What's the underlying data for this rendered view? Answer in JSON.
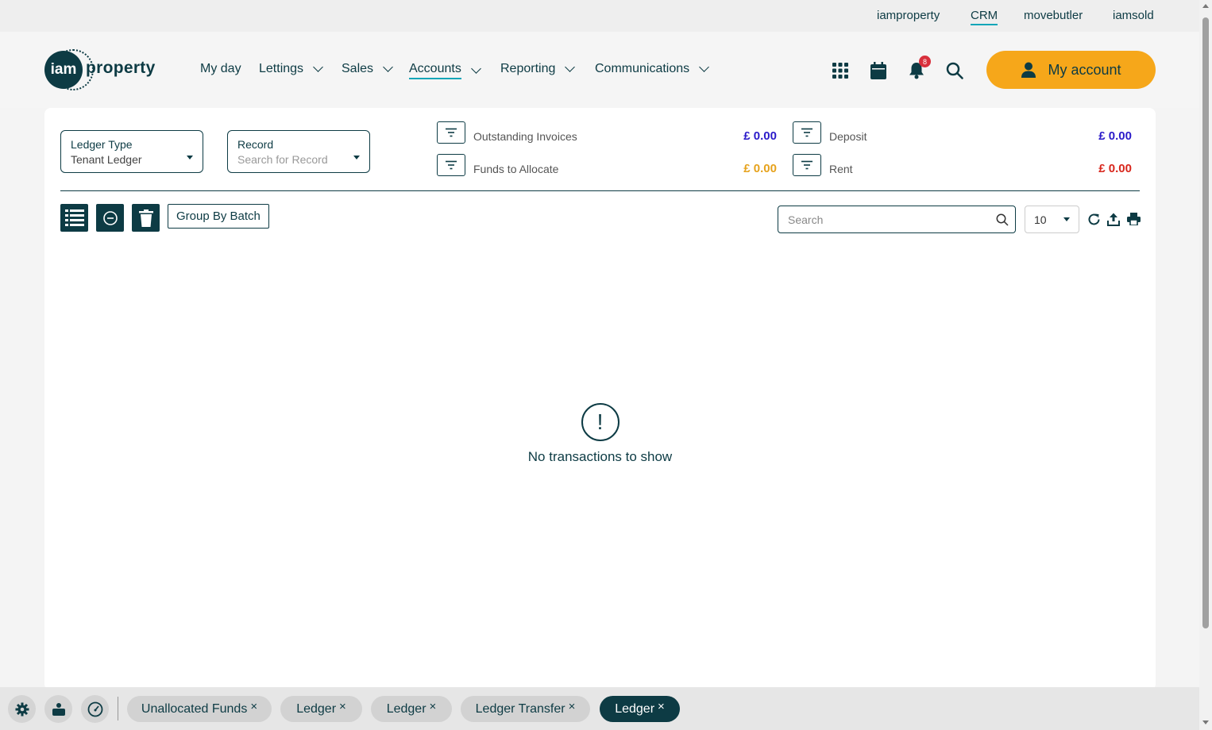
{
  "brandbar": {
    "links": [
      {
        "label": "iamproperty",
        "active": false
      },
      {
        "label": "CRM",
        "active": true
      },
      {
        "label": "movebutler",
        "active": false
      },
      {
        "label": "iamsold",
        "active": false
      }
    ]
  },
  "header": {
    "logo_short": "iam",
    "logo_text": "property",
    "nav": [
      {
        "label": "My day",
        "dropdown": false
      },
      {
        "label": "Lettings",
        "dropdown": true
      },
      {
        "label": "Sales",
        "dropdown": true
      },
      {
        "label": "Accounts",
        "dropdown": true,
        "active": true
      },
      {
        "label": "Reporting",
        "dropdown": true
      },
      {
        "label": "Communications",
        "dropdown": true
      }
    ],
    "icons": [
      "apps-grid-icon",
      "calendar-icon",
      "bell-icon",
      "search-icon"
    ],
    "notification_count": "8",
    "account_label": "My account"
  },
  "filters": {
    "ledger_type": {
      "label": "Ledger Type",
      "value": "Tenant Ledger"
    },
    "record": {
      "label": "Record",
      "placeholder": "Search for Record"
    }
  },
  "summary": {
    "outstanding_invoices": {
      "label": "Outstanding Invoices",
      "amount": "£ 0.00",
      "color": "#2a1ac9"
    },
    "funds_to_allocate": {
      "label": "Funds to Allocate",
      "amount": "£ 0.00",
      "color": "#e6a21c"
    },
    "deposit": {
      "label": "Deposit",
      "amount": "£ 0.00",
      "color": "#2a1ac9"
    },
    "rent": {
      "label": "Rent",
      "amount": "£ 0.00",
      "color": "#d8261c"
    }
  },
  "toolbar": {
    "group_by_batch": "Group By Batch",
    "search_placeholder": "Search",
    "page_size": "10"
  },
  "empty_state": {
    "icon": "!",
    "message": "No transactions to show"
  },
  "bottombar": {
    "tabs": [
      {
        "label": "Unallocated Funds",
        "active": false
      },
      {
        "label": "Ledger",
        "active": false
      },
      {
        "label": "Ledger",
        "active": false
      },
      {
        "label": "Ledger Transfer",
        "active": false
      },
      {
        "label": "Ledger",
        "active": true
      }
    ],
    "close_glyph": "×"
  },
  "colors": {
    "primary": "#0d3b44",
    "accent": "#f6a71a",
    "link_underline": "#12a6b8",
    "badge": "#d8303c"
  }
}
